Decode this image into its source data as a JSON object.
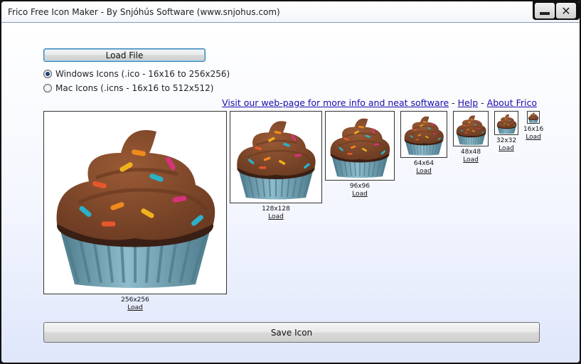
{
  "window": {
    "title": "Frico Free Icon Maker - By Snjóhús Software (www.snjohus.com)",
    "minimize_glyph": "",
    "close_glyph": "✕"
  },
  "toolbar": {
    "load_file_label": "Load File",
    "save_icon_label": "Save Icon"
  },
  "format_options": [
    {
      "label": "Windows Icons (.ico - 16x16 to 256x256)",
      "selected": true
    },
    {
      "label": "Mac Icons (.icns - 16x16 to 512x512)",
      "selected": false
    }
  ],
  "links": {
    "website": "Visit our web-page for more info and neat software",
    "separator": "-",
    "help": "Help",
    "about": "About Frico"
  },
  "icons": [
    {
      "size": "256x256",
      "load": "Load"
    },
    {
      "size": "128x128",
      "load": "Load"
    },
    {
      "size": "96x96",
      "load": "Load"
    },
    {
      "size": "64x64",
      "load": "Load"
    },
    {
      "size": "48x48",
      "load": "Load"
    },
    {
      "size": "32x32",
      "load": "Load"
    },
    {
      "size": "16x16",
      "load": "Load"
    }
  ],
  "icon_subject": "cupcake-icon",
  "colors": {
    "frosting": "#6b3b22",
    "frosting_light": "#9a5a35",
    "cake": "#3a1f14",
    "wrapper": "#8fbccc",
    "wrapper_dark": "#4f7d8d",
    "sprinkles": [
      "#e6572b",
      "#f0b21c",
      "#2ab1c9",
      "#d8327c",
      "#f08a1c"
    ]
  }
}
